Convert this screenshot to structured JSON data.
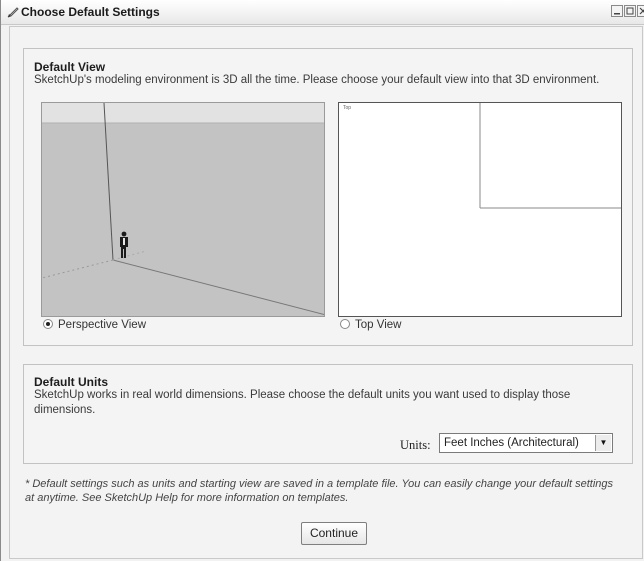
{
  "window": {
    "title": "Choose Default Settings",
    "title_icon": "pencil-icon"
  },
  "default_view": {
    "title": "Default View",
    "description": "SketchUp's modeling environment is 3D all the time. Please choose your default view into that 3D environment.",
    "options": [
      {
        "label": "Perspective View",
        "selected": true
      },
      {
        "label": "Top View",
        "selected": false
      }
    ],
    "top_preview_label": "Top"
  },
  "default_units": {
    "title": "Default Units",
    "description": "SketchUp works in real world dimensions. Please choose the default units you want used to display those dimensions.",
    "units_label": "Units:",
    "selected_unit": "Feet Inches (Architectural)"
  },
  "footnote": "* Default settings such as units and starting view are saved in a template file. You can easily change your default settings at anytime. See SketchUp Help for more information on templates.",
  "continue_label": "Continue"
}
